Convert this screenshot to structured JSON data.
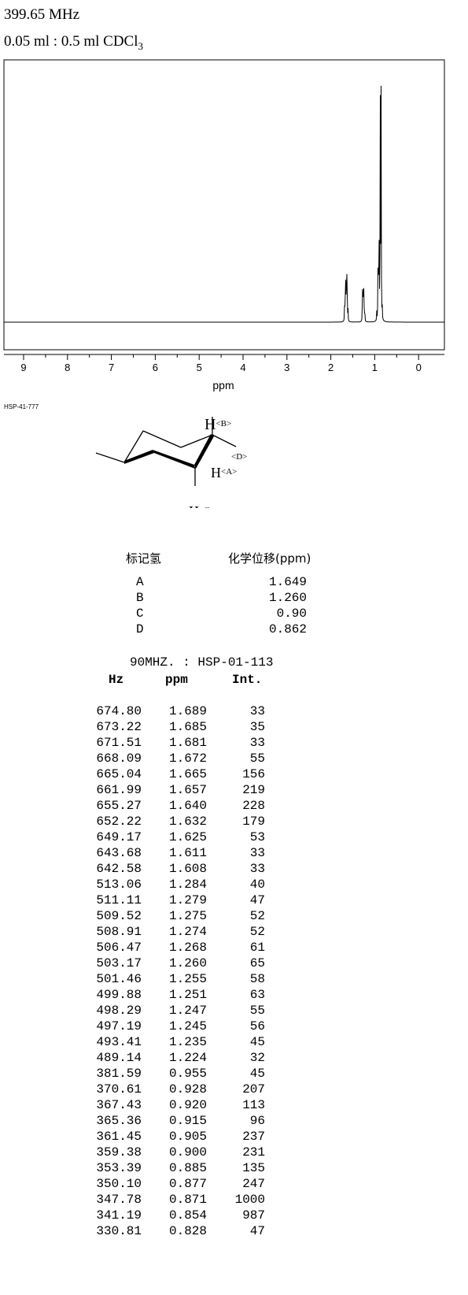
{
  "header": {
    "frequency": "399.65 MHz",
    "solvent": "0.05 ml : 0.5 ml CDCl",
    "solvent_subscript": "3"
  },
  "chart_data": {
    "type": "line",
    "title": "",
    "xlabel": "ppm",
    "ylabel": "",
    "x_ticks": [
      "9",
      "8",
      "7",
      "6",
      "5",
      "4",
      "3",
      "2",
      "1",
      "0"
    ],
    "xlim": [
      9.5,
      -0.5
    ],
    "x_reversed": true,
    "grid": false,
    "peaks": [
      {
        "ppm": 1.649,
        "height": 228
      },
      {
        "ppm": 1.26,
        "height": 65
      },
      {
        "ppm": 0.9,
        "height": 247
      },
      {
        "ppm": 0.871,
        "height": 1000
      }
    ]
  },
  "source_label": "HSP-41-777",
  "structure": {
    "labels": [
      "H<B>",
      "<D>",
      "H<A>",
      "H<C>"
    ]
  },
  "assignment": {
    "col_label": "标记氢",
    "col_shift": "化学位移(ppm)",
    "rows": [
      {
        "label": "A",
        "shift": "1.649"
      },
      {
        "label": "B",
        "shift": "1.260"
      },
      {
        "label": "C",
        "shift": "0.90"
      },
      {
        "label": "D",
        "shift": "0.862"
      }
    ]
  },
  "peak_list": {
    "title": "90MHZ. : HSP-01-113",
    "headers": [
      "Hz",
      "ppm",
      "Int."
    ],
    "rows": [
      [
        "674.80",
        "1.689",
        "33"
      ],
      [
        "673.22",
        "1.685",
        "35"
      ],
      [
        "671.51",
        "1.681",
        "33"
      ],
      [
        "668.09",
        "1.672",
        "55"
      ],
      [
        "665.04",
        "1.665",
        "156"
      ],
      [
        "661.99",
        "1.657",
        "219"
      ],
      [
        "655.27",
        "1.640",
        "228"
      ],
      [
        "652.22",
        "1.632",
        "179"
      ],
      [
        "649.17",
        "1.625",
        "53"
      ],
      [
        "643.68",
        "1.611",
        "33"
      ],
      [
        "642.58",
        "1.608",
        "33"
      ],
      [
        "513.06",
        "1.284",
        "40"
      ],
      [
        "511.11",
        "1.279",
        "47"
      ],
      [
        "509.52",
        "1.275",
        "52"
      ],
      [
        "508.91",
        "1.274",
        "52"
      ],
      [
        "506.47",
        "1.268",
        "61"
      ],
      [
        "503.17",
        "1.260",
        "65"
      ],
      [
        "501.46",
        "1.255",
        "58"
      ],
      [
        "499.88",
        "1.251",
        "63"
      ],
      [
        "498.29",
        "1.247",
        "55"
      ],
      [
        "497.19",
        "1.245",
        "56"
      ],
      [
        "493.41",
        "1.235",
        "45"
      ],
      [
        "489.14",
        "1.224",
        "32"
      ],
      [
        "381.59",
        "0.955",
        "45"
      ],
      [
        "370.61",
        "0.928",
        "207"
      ],
      [
        "367.43",
        "0.920",
        "113"
      ],
      [
        "365.36",
        "0.915",
        "96"
      ],
      [
        "361.45",
        "0.905",
        "237"
      ],
      [
        "359.38",
        "0.900",
        "231"
      ],
      [
        "353.39",
        "0.885",
        "135"
      ],
      [
        "350.10",
        "0.877",
        "247"
      ],
      [
        "347.78",
        "0.871",
        "1000"
      ],
      [
        "341.19",
        "0.854",
        "987"
      ],
      [
        "330.81",
        "0.828",
        "47"
      ]
    ]
  }
}
